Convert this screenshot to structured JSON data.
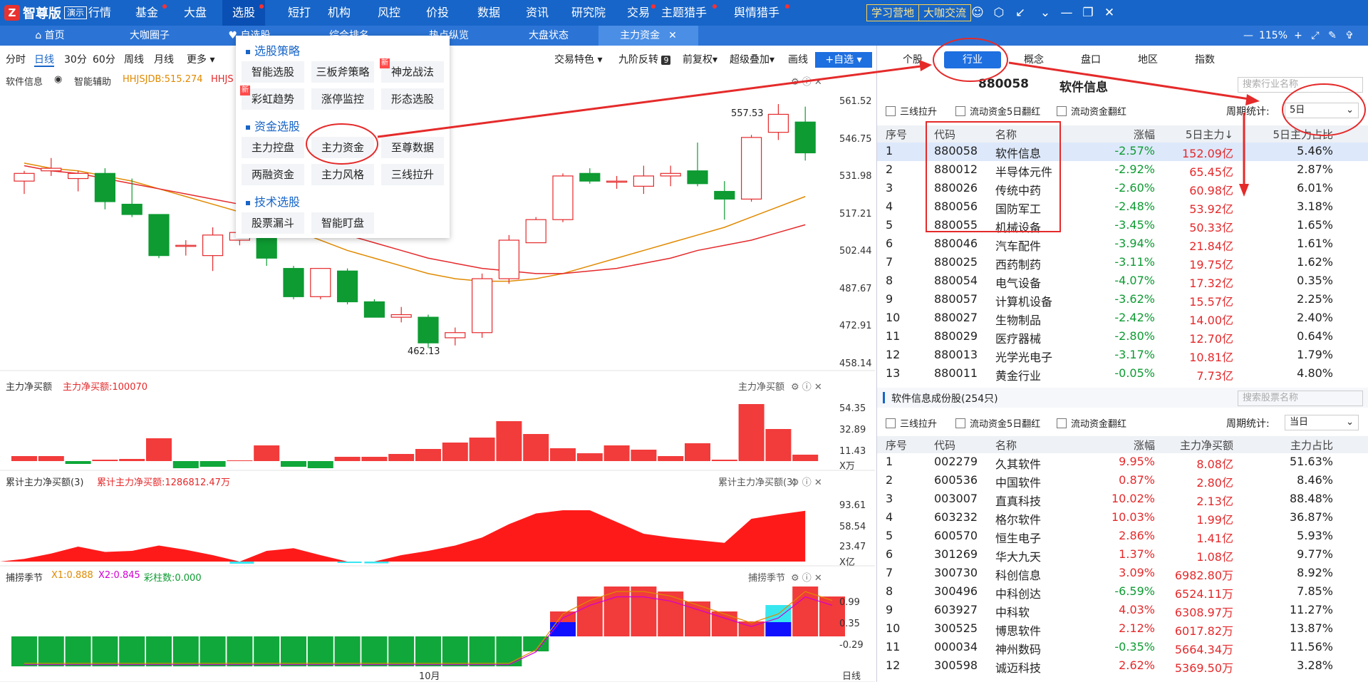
{
  "topbar": {
    "logo_text": "智尊版",
    "logo_badge": "演示",
    "nav": [
      "行情",
      "基金",
      "大盘",
      "选股",
      "短打",
      "机构",
      "风控",
      "价投",
      "数据",
      "资讯",
      "研究院",
      "交易",
      "主题猎手",
      "舆情猎手"
    ],
    "study_btn": "学习营地",
    "coffee_btn": "大咖交流"
  },
  "tabbar": {
    "tabs": [
      "首页",
      "大咖圈子",
      "自选股",
      "综合排名",
      "热点纵览",
      "大盘状态",
      "主力资金"
    ],
    "zoom": "115%"
  },
  "toolbar": {
    "periods": [
      "分时",
      "日线",
      "30分",
      "60分",
      "周线",
      "月线",
      "更多"
    ],
    "selected": "日线",
    "tools": [
      "交易特色",
      "九阶反转",
      "前复权",
      "超级叠加",
      "画线"
    ],
    "badge9": "9",
    "add_label": "+自选"
  },
  "chart": {
    "stock": "软件信息",
    "assist": "智能辅助",
    "ind_label": "HHJSJDB:515.274",
    "ind_label2": "HHJS",
    "high_label": "557.53",
    "low_label": "462.13",
    "price_ticks": [
      "561.52",
      "546.75",
      "531.98",
      "517.21",
      "502.44",
      "487.67",
      "472.91",
      "458.14"
    ],
    "p1_title": "主力净买额",
    "p1_val": "主力净买额:100070",
    "p1_ticks": [
      "54.35",
      "32.89",
      "11.43"
    ],
    "p1_unit": "X万",
    "p2_title": "累计主力净买额(3)",
    "p2_val": "累计主力净买额:1286812.47万",
    "p2_ticks": [
      "93.61",
      "58.54",
      "23.47"
    ],
    "p2_unit": "X亿",
    "p3_title": "捕捞季节",
    "p3_x1": "X1:0.888",
    "p3_x2": "X2:0.845",
    "p3_bars": "彩柱数:0.000",
    "p3_ticks": [
      "0.99",
      "0.35",
      "-0.29"
    ],
    "month_label": "10月",
    "period_label": "日线"
  },
  "chart_data": {
    "type": "candlestick",
    "candles": [
      {
        "o": 527,
        "h": 531,
        "l": 522,
        "c": 530
      },
      {
        "o": 531,
        "h": 536,
        "l": 529,
        "c": 532
      },
      {
        "o": 528,
        "h": 531,
        "l": 523,
        "c": 530
      },
      {
        "o": 530,
        "h": 532,
        "l": 516,
        "c": 519
      },
      {
        "o": 518,
        "h": 528,
        "l": 513,
        "c": 514
      },
      {
        "o": 514,
        "h": 514,
        "l": 497,
        "c": 498
      },
      {
        "o": 502,
        "h": 504,
        "l": 498,
        "c": 502
      },
      {
        "o": 498,
        "h": 509,
        "l": 492,
        "c": 506
      },
      {
        "o": 504,
        "h": 509,
        "l": 502,
        "c": 507
      },
      {
        "o": 508,
        "h": 511,
        "l": 494,
        "c": 497
      },
      {
        "o": 493,
        "h": 494,
        "l": 481,
        "c": 482
      },
      {
        "o": 482,
        "h": 493,
        "l": 481,
        "c": 493
      },
      {
        "o": 492,
        "h": 493,
        "l": 479,
        "c": 480
      },
      {
        "o": 480,
        "h": 481,
        "l": 474,
        "c": 474
      },
      {
        "o": 474,
        "h": 478,
        "l": 472,
        "c": 475
      },
      {
        "o": 474,
        "h": 475,
        "l": 462,
        "c": 464
      },
      {
        "o": 466,
        "h": 470,
        "l": 463,
        "c": 468
      },
      {
        "o": 468,
        "h": 491,
        "l": 466,
        "c": 489
      },
      {
        "o": 489,
        "h": 506,
        "l": 487,
        "c": 504
      },
      {
        "o": 503,
        "h": 513,
        "l": 503,
        "c": 512
      },
      {
        "o": 512,
        "h": 530,
        "l": 511,
        "c": 529
      },
      {
        "o": 530,
        "h": 532,
        "l": 526,
        "c": 527
      },
      {
        "o": 527,
        "h": 529,
        "l": 524,
        "c": 527
      },
      {
        "o": 525,
        "h": 533,
        "l": 522,
        "c": 529
      },
      {
        "o": 529,
        "h": 533,
        "l": 525,
        "c": 530
      },
      {
        "o": 531,
        "h": 542,
        "l": 525,
        "c": 526
      },
      {
        "o": 523,
        "h": 527,
        "l": 512,
        "c": 520
      },
      {
        "o": 520,
        "h": 545,
        "l": 519,
        "c": 544
      },
      {
        "o": 546,
        "h": 557,
        "l": 543,
        "c": 553
      },
      {
        "o": 550,
        "h": 556,
        "l": 535,
        "c": 538
      }
    ],
    "ma_a": [
      534,
      532,
      531,
      529,
      527,
      524,
      521,
      518,
      515,
      512,
      508,
      504,
      500,
      497,
      494,
      491,
      489,
      488,
      488,
      489,
      491,
      494,
      497,
      500,
      503,
      506,
      509,
      513,
      517,
      521
    ],
    "ma_b": [
      533,
      531,
      530,
      528,
      526,
      524,
      522,
      520,
      518,
      515,
      512,
      509,
      506,
      503,
      500,
      497,
      495,
      493,
      492,
      491,
      491,
      492,
      493,
      495,
      497,
      500,
      502,
      504,
      507,
      510
    ],
    "main_net": [
      7,
      7,
      -4,
      2,
      3,
      32,
      -10,
      -8,
      1,
      22,
      -8,
      -10,
      6,
      6,
      10,
      17,
      26,
      33,
      56,
      38,
      18,
      11,
      22,
      16,
      7,
      25,
      2,
      80,
      45,
      9
    ],
    "cum_net": [
      5,
      15,
      28,
      18,
      20,
      30,
      22,
      12,
      -6,
      20,
      25,
      12,
      -4,
      -5,
      12,
      20,
      30,
      45,
      70,
      90,
      96,
      96,
      74,
      52,
      45,
      40,
      35,
      80,
      88,
      95
    ],
    "season": [
      -6,
      -6,
      -6,
      -6,
      -6,
      -6,
      -6,
      -6,
      -6,
      -6,
      -6,
      -6,
      -6,
      -6,
      -6,
      -6,
      -6,
      -6,
      -6,
      -3,
      5,
      8,
      10,
      10,
      9,
      7,
      5,
      3,
      5,
      10,
      8
    ],
    "xlim": [
      0,
      30
    ]
  },
  "menu": {
    "sec1": "选股策略",
    "sec1_items": [
      "智能选股",
      "三板斧策略",
      "神龙战法",
      "彩虹趋势",
      "涨停监控",
      "形态选股"
    ],
    "sec2": "资金选股",
    "sec2_items": [
      "主力控盘",
      "主力资金",
      "至尊数据",
      "两融资金",
      "主力风格",
      "三线拉升"
    ],
    "sec3": "技术选股",
    "sec3_items": [
      "股票漏斗",
      "智能盯盘"
    ],
    "new_tag": "新"
  },
  "right": {
    "tabs": [
      "个股",
      "行业",
      "概念",
      "盘口",
      "地区",
      "指数"
    ],
    "selected_tab": "行业",
    "header_code": "880058",
    "header_name": "软件信息",
    "search1": "搜索行业名称",
    "search2": "搜索股票名称",
    "chk": [
      "三线拉升",
      "流动资金5日翻红",
      "流动资金翻红"
    ],
    "period_label": "周期统计:",
    "period_val1": "5日",
    "period_val2": "当日",
    "t1_head": [
      "序号",
      "代码",
      "名称",
      "涨幅",
      "5日主力↓",
      "5日主力占比"
    ],
    "t1_rows": [
      [
        "1",
        "880058",
        "软件信息",
        "-2.57%",
        "152.09亿",
        "5.46%"
      ],
      [
        "2",
        "880012",
        "半导体元件",
        "-2.92%",
        "65.45亿",
        "2.87%"
      ],
      [
        "3",
        "880026",
        "传统中药",
        "-2.60%",
        "60.98亿",
        "6.01%"
      ],
      [
        "4",
        "880056",
        "国防军工",
        "-2.48%",
        "53.92亿",
        "3.18%"
      ],
      [
        "5",
        "880055",
        "机械设备",
        "-3.45%",
        "50.33亿",
        "1.65%"
      ],
      [
        "6",
        "880046",
        "汽车配件",
        "-3.94%",
        "21.84亿",
        "1.61%"
      ],
      [
        "7",
        "880025",
        "西药制药",
        "-3.11%",
        "19.75亿",
        "1.62%"
      ],
      [
        "8",
        "880054",
        "电气设备",
        "-4.07%",
        "17.32亿",
        "0.35%"
      ],
      [
        "9",
        "880057",
        "计算机设备",
        "-3.62%",
        "15.57亿",
        "2.25%"
      ],
      [
        "10",
        "880027",
        "生物制品",
        "-2.42%",
        "14.00亿",
        "2.40%"
      ],
      [
        "11",
        "880029",
        "医疗器械",
        "-2.80%",
        "12.70亿",
        "0.64%"
      ],
      [
        "12",
        "880013",
        "光学光电子",
        "-3.17%",
        "10.81亿",
        "1.79%"
      ],
      [
        "13",
        "880011",
        "黄金行业",
        "-0.05%",
        "7.73亿",
        "4.80%"
      ]
    ],
    "sub_title": "软件信息成份股(254只)",
    "t2_head": [
      "序号",
      "代码",
      "名称",
      "涨幅",
      "主力净买额",
      "主力占比"
    ],
    "t2_rows": [
      [
        "1",
        "002279",
        "久其软件",
        "9.95%",
        "8.08亿",
        "51.63%"
      ],
      [
        "2",
        "600536",
        "中国软件",
        "0.87%",
        "2.80亿",
        "8.46%"
      ],
      [
        "3",
        "003007",
        "直真科技",
        "10.02%",
        "2.13亿",
        "88.48%"
      ],
      [
        "4",
        "603232",
        "格尔软件",
        "10.03%",
        "1.99亿",
        "36.87%"
      ],
      [
        "5",
        "600570",
        "恒生电子",
        "2.86%",
        "1.41亿",
        "5.93%"
      ],
      [
        "6",
        "301269",
        "华大九天",
        "1.37%",
        "1.08亿",
        "9.77%"
      ],
      [
        "7",
        "300730",
        "科创信息",
        "3.09%",
        "6982.80万",
        "8.92%"
      ],
      [
        "8",
        "300496",
        "中科创达",
        "-6.59%",
        "6524.11万",
        "7.85%"
      ],
      [
        "9",
        "603927",
        "中科软",
        "4.03%",
        "6308.97万",
        "11.27%"
      ],
      [
        "10",
        "300525",
        "博思软件",
        "2.12%",
        "6017.82万",
        "13.87%"
      ],
      [
        "11",
        "000034",
        "神州数码",
        "-0.35%",
        "5664.34万",
        "11.56%"
      ],
      [
        "12",
        "300598",
        "诚迈科技",
        "2.62%",
        "5369.50万",
        "3.28%"
      ]
    ]
  },
  "colors": {
    "accent": "#1765c8",
    "up": "#e5292b",
    "down": "#0d9b32"
  }
}
